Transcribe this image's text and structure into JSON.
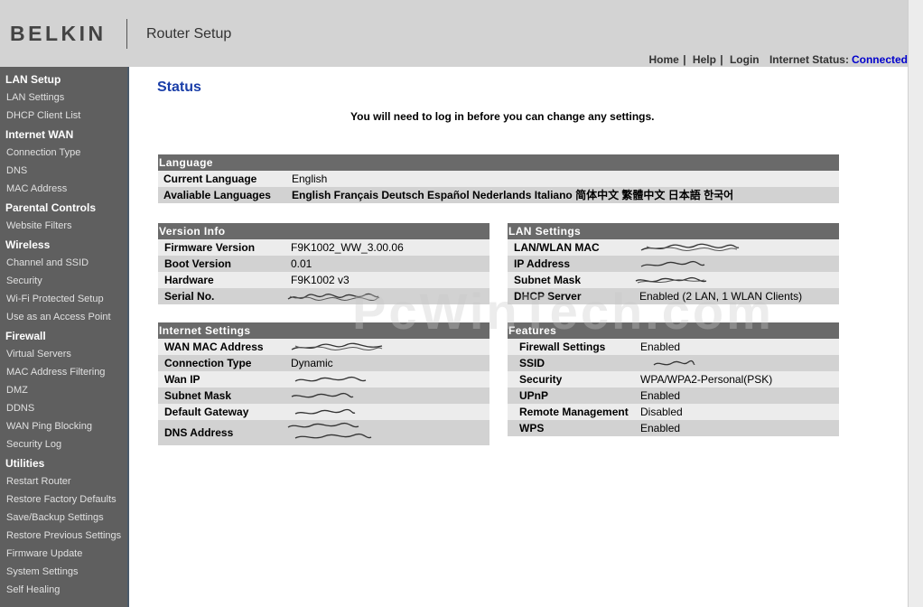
{
  "header": {
    "logo": "BELKIN",
    "app_title": "Router Setup",
    "nav": {
      "home": "Home",
      "help": "Help",
      "login": "Login",
      "sep": "|"
    },
    "internet_status_label": "Internet Status:",
    "internet_status_value": "Connected"
  },
  "sidebar": {
    "sections": [
      {
        "title": "LAN Setup",
        "items": [
          "LAN Settings",
          "DHCP Client List"
        ]
      },
      {
        "title": "Internet WAN",
        "items": [
          "Connection Type",
          "DNS",
          "MAC Address"
        ]
      },
      {
        "title": "Parental Controls",
        "items": [
          "Website Filters"
        ]
      },
      {
        "title": "Wireless",
        "items": [
          "Channel and SSID",
          "Security",
          "Wi-Fi Protected Setup",
          "Use as an Access Point"
        ]
      },
      {
        "title": "Firewall",
        "items": [
          "Virtual Servers",
          "MAC Address Filtering",
          "DMZ",
          "DDNS",
          "WAN Ping Blocking",
          "Security Log"
        ]
      },
      {
        "title": "Utilities",
        "items": [
          "Restart Router",
          "Restore Factory Defaults",
          "Save/Backup Settings",
          "Restore Previous Settings",
          "Firmware Update",
          "System Settings",
          "Self Healing"
        ]
      }
    ]
  },
  "main": {
    "page_title": "Status",
    "login_notice": "You will need to log in before you can change any settings.",
    "watermark": "PcWinTech.com",
    "language": {
      "title": "Language",
      "current_label": "Current Language",
      "current_value": "English",
      "available_label": "Avaliable Languages",
      "available_value": "English Français Deutsch Español Nederlands Italiano 简体中文 繁體中文 日本語 한국어"
    },
    "version_info": {
      "title": "Version Info",
      "rows": [
        {
          "label": "Firmware Version",
          "value": "F9K1002_WW_3.00.06"
        },
        {
          "label": "Boot Version",
          "value": "0.01"
        },
        {
          "label": "Hardware",
          "value": "F9K1002 v3"
        },
        {
          "label": "Serial No.",
          "value": ""
        }
      ]
    },
    "lan_settings": {
      "title": "LAN Settings",
      "rows": [
        {
          "label": "LAN/WLAN MAC",
          "value": ""
        },
        {
          "label": "IP Address",
          "value": ""
        },
        {
          "label": "Subnet Mask",
          "value": ""
        },
        {
          "label": "DHCP Server",
          "value": "Enabled (2 LAN, 1 WLAN Clients)"
        }
      ]
    },
    "internet_settings": {
      "title": "Internet Settings",
      "rows": [
        {
          "label": "WAN MAC Address",
          "value": ""
        },
        {
          "label": "Connection Type",
          "value": "Dynamic"
        },
        {
          "label": "Wan IP",
          "value": ""
        },
        {
          "label": "Subnet Mask",
          "value": ""
        },
        {
          "label": "Default Gateway",
          "value": ""
        },
        {
          "label": "DNS Address",
          "value": ""
        }
      ]
    },
    "features": {
      "title": "Features",
      "rows": [
        {
          "label": "Firewall Settings",
          "value": "Enabled"
        },
        {
          "label": "SSID",
          "value": ""
        },
        {
          "label": "Security",
          "value": "WPA/WPA2-Personal(PSK)"
        },
        {
          "label": "UPnP",
          "value": "Enabled"
        },
        {
          "label": "Remote Management",
          "value": "Disabled"
        },
        {
          "label": "WPS",
          "value": "Enabled"
        }
      ]
    }
  }
}
